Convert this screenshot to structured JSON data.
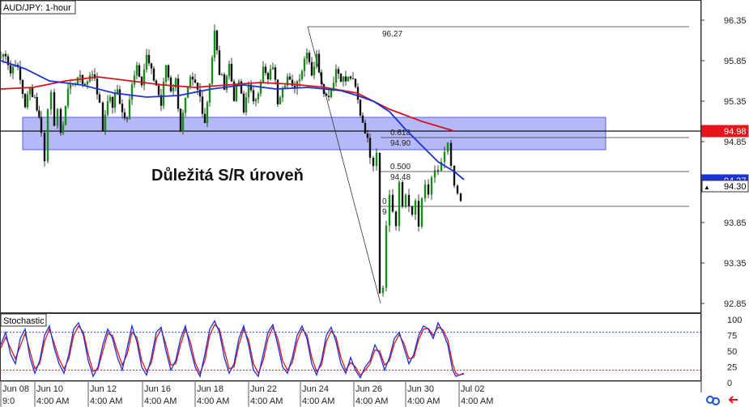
{
  "chart_data": {
    "type": "candlestick",
    "title": "AUD/JPY: 1-hour",
    "price_axis": {
      "ylim": [
        92.74,
        96.58
      ],
      "ticks": [
        "96.35",
        "95.85",
        "95.35",
        "94.85",
        "93.85",
        "93.35",
        "92.85"
      ],
      "tick_values": [
        96.35,
        95.85,
        95.35,
        94.85,
        93.85,
        93.35,
        92.85
      ]
    },
    "x_axis": {
      "date_labels": [
        "Jun 08",
        "Jun 10",
        "Jun 12",
        "Jun 16",
        "Jun 18",
        "Jun 22",
        "Jun 24",
        "Jun 26",
        "Jun 30",
        "Jul 02"
      ],
      "time_labels": [
        "9:0",
        "4:00 AM",
        "4:00 AM",
        "4:00 AM",
        "4:00 AM",
        "4:00 AM",
        "4:00 AM",
        "4:00 AM",
        "4:00 AM",
        "4:00 AM"
      ]
    },
    "close_path": [
      [
        0,
        95.9
      ],
      [
        6,
        95.95
      ],
      [
        12,
        95.7
      ],
      [
        18,
        95.85
      ],
      [
        24,
        95.6
      ],
      [
        30,
        95.3
      ],
      [
        36,
        95.5
      ],
      [
        42,
        95.4
      ],
      [
        50,
        95.0
      ],
      [
        54,
        94.6
      ],
      [
        58,
        95.25
      ],
      [
        62,
        95.5
      ],
      [
        66,
        95.1
      ],
      [
        70,
        95.2
      ],
      [
        74,
        94.9
      ],
      [
        80,
        95.3
      ],
      [
        86,
        95.6
      ],
      [
        92,
        95.55
      ],
      [
        98,
        95.7
      ],
      [
        104,
        95.5
      ],
      [
        110,
        95.7
      ],
      [
        116,
        95.65
      ],
      [
        122,
        95.3
      ],
      [
        126,
        95.0
      ],
      [
        132,
        95.4
      ],
      [
        138,
        95.3
      ],
      [
        144,
        95.5
      ],
      [
        150,
        95.2
      ],
      [
        156,
        95.1
      ],
      [
        162,
        95.6
      ],
      [
        168,
        95.8
      ],
      [
        174,
        95.6
      ],
      [
        180,
        95.9
      ],
      [
        186,
        95.7
      ],
      [
        192,
        95.55
      ],
      [
        198,
        95.3
      ],
      [
        204,
        95.8
      ],
      [
        210,
        95.5
      ],
      [
        216,
        95.6
      ],
      [
        222,
        95.0
      ],
      [
        228,
        95.35
      ],
      [
        234,
        95.6
      ],
      [
        240,
        95.55
      ],
      [
        246,
        95.4
      ],
      [
        252,
        95.1
      ],
      [
        258,
        95.6
      ],
      [
        264,
        96.2
      ],
      [
        270,
        95.7
      ],
      [
        276,
        95.55
      ],
      [
        282,
        95.8
      ],
      [
        288,
        95.4
      ],
      [
        294,
        95.6
      ],
      [
        300,
        95.2
      ],
      [
        306,
        95.6
      ],
      [
        312,
        95.3
      ],
      [
        318,
        95.5
      ],
      [
        324,
        95.75
      ],
      [
        330,
        95.6
      ],
      [
        336,
        95.8
      ],
      [
        342,
        95.35
      ],
      [
        348,
        95.55
      ],
      [
        354,
        95.65
      ],
      [
        360,
        95.5
      ],
      [
        366,
        95.6
      ],
      [
        372,
        95.75
      ],
      [
        378,
        96.0
      ],
      [
        384,
        95.7
      ],
      [
        390,
        95.9
      ],
      [
        396,
        95.6
      ],
      [
        402,
        95.4
      ],
      [
        408,
        95.5
      ],
      [
        414,
        95.75
      ],
      [
        420,
        95.65
      ],
      [
        426,
        95.6
      ],
      [
        432,
        95.65
      ],
      [
        438,
        95.5
      ],
      [
        444,
        95.2
      ],
      [
        450,
        95.0
      ],
      [
        456,
        94.7
      ],
      [
        460,
        94.6
      ],
      [
        464,
        94.75
      ],
      [
        468,
        93.0
      ],
      [
        472,
        93.1
      ],
      [
        476,
        93.8
      ],
      [
        480,
        94.2
      ],
      [
        484,
        94.0
      ],
      [
        488,
        93.8
      ],
      [
        492,
        94.3
      ],
      [
        496,
        94.05
      ],
      [
        500,
        94.2
      ],
      [
        504,
        94.1
      ],
      [
        508,
        93.9
      ],
      [
        512,
        94.1
      ],
      [
        516,
        93.8
      ],
      [
        520,
        94.1
      ],
      [
        524,
        94.3
      ],
      [
        528,
        94.2
      ],
      [
        532,
        94.35
      ],
      [
        536,
        94.45
      ],
      [
        540,
        94.5
      ],
      [
        544,
        94.6
      ],
      [
        548,
        94.7
      ],
      [
        552,
        94.8
      ],
      [
        556,
        94.5
      ],
      [
        560,
        94.3
      ],
      [
        564,
        94.15
      ],
      [
        568,
        94.1
      ],
      [
        572,
        94.3
      ]
    ],
    "ma_blue": [
      [
        0,
        95.85
      ],
      [
        30,
        95.75
      ],
      [
        60,
        95.6
      ],
      [
        100,
        95.55
      ],
      [
        140,
        95.45
      ],
      [
        180,
        95.4
      ],
      [
        220,
        95.42
      ],
      [
        260,
        95.5
      ],
      [
        300,
        95.55
      ],
      [
        340,
        95.5
      ],
      [
        380,
        95.52
      ],
      [
        420,
        95.48
      ],
      [
        440,
        95.42
      ],
      [
        460,
        95.35
      ],
      [
        480,
        95.22
      ],
      [
        500,
        95.0
      ],
      [
        520,
        94.8
      ],
      [
        540,
        94.6
      ],
      [
        560,
        94.48
      ],
      [
        572,
        94.38
      ]
    ],
    "ma_red": [
      [
        0,
        95.5
      ],
      [
        40,
        95.52
      ],
      [
        80,
        95.6
      ],
      [
        120,
        95.65
      ],
      [
        160,
        95.6
      ],
      [
        200,
        95.55
      ],
      [
        240,
        95.52
      ],
      [
        280,
        95.55
      ],
      [
        320,
        95.58
      ],
      [
        360,
        95.56
      ],
      [
        400,
        95.52
      ],
      [
        440,
        95.45
      ],
      [
        480,
        95.25
      ],
      [
        520,
        95.1
      ],
      [
        560,
        94.98
      ]
    ],
    "horizontal_line": {
      "price": 94.98
    },
    "sr_zone": {
      "from": 94.75,
      "to": 95.15,
      "label": "Důležitá S/R úroveň"
    },
    "fibonacci": {
      "high": 96.27,
      "high_label": "96.27",
      "low": 92.85,
      "levels": [
        {
          "ratio": "0.618",
          "price": 94.9,
          "price_label": "94.90"
        },
        {
          "ratio": "0.500",
          "price": 94.48,
          "price_label": "94.48"
        },
        {
          "ratio": "0",
          "price": 94.05,
          "price_label": "9"
        }
      ]
    },
    "price_badges": [
      {
        "label": "94.98",
        "price": 94.98,
        "color": "#e8141c",
        "text_color": "#ffffff"
      },
      {
        "label": "94.37",
        "price": 94.37,
        "color": "#1a32d6",
        "text_color": "#ffffff"
      },
      {
        "label": "94.30",
        "price": 94.3,
        "color": "#ffffff",
        "text_color": "#000000",
        "marker": "▲"
      }
    ],
    "stochastic": {
      "title": "Stochastic",
      "ticks": [
        "100",
        "75",
        "50",
        "25",
        "0"
      ],
      "tick_values": [
        100,
        75,
        50,
        25,
        0
      ],
      "upper": 80,
      "lower": 20,
      "k": [
        [
          0,
          60
        ],
        [
          6,
          80
        ],
        [
          12,
          45
        ],
        [
          18,
          30
        ],
        [
          24,
          70
        ],
        [
          30,
          85
        ],
        [
          36,
          40
        ],
        [
          42,
          15
        ],
        [
          48,
          35
        ],
        [
          54,
          75
        ],
        [
          60,
          90
        ],
        [
          66,
          55
        ],
        [
          72,
          30
        ],
        [
          78,
          15
        ],
        [
          84,
          45
        ],
        [
          90,
          85
        ],
        [
          96,
          95
        ],
        [
          102,
          75
        ],
        [
          108,
          35
        ],
        [
          114,
          10
        ],
        [
          120,
          25
        ],
        [
          126,
          60
        ],
        [
          132,
          85
        ],
        [
          138,
          70
        ],
        [
          144,
          40
        ],
        [
          150,
          20
        ],
        [
          156,
          55
        ],
        [
          162,
          90
        ],
        [
          168,
          65
        ],
        [
          174,
          25
        ],
        [
          180,
          12
        ],
        [
          186,
          40
        ],
        [
          192,
          80
        ],
        [
          198,
          88
        ],
        [
          204,
          50
        ],
        [
          210,
          20
        ],
        [
          216,
          35
        ],
        [
          222,
          70
        ],
        [
          228,
          90
        ],
        [
          234,
          55
        ],
        [
          240,
          25
        ],
        [
          246,
          10
        ],
        [
          252,
          45
        ],
        [
          258,
          85
        ],
        [
          264,
          98
        ],
        [
          270,
          80
        ],
        [
          276,
          40
        ],
        [
          282,
          15
        ],
        [
          288,
          30
        ],
        [
          294,
          70
        ],
        [
          300,
          90
        ],
        [
          306,
          60
        ],
        [
          312,
          20
        ],
        [
          318,
          10
        ],
        [
          324,
          45
        ],
        [
          330,
          80
        ],
        [
          336,
          92
        ],
        [
          342,
          60
        ],
        [
          348,
          25
        ],
        [
          354,
          15
        ],
        [
          360,
          40
        ],
        [
          366,
          75
        ],
        [
          372,
          90
        ],
        [
          378,
          70
        ],
        [
          384,
          30
        ],
        [
          390,
          12
        ],
        [
          396,
          35
        ],
        [
          402,
          75
        ],
        [
          408,
          88
        ],
        [
          414,
          65
        ],
        [
          420,
          30
        ],
        [
          426,
          15
        ],
        [
          432,
          40
        ],
        [
          438,
          20
        ],
        [
          444,
          8
        ],
        [
          450,
          25
        ],
        [
          456,
          35
        ],
        [
          462,
          60
        ],
        [
          468,
          45
        ],
        [
          474,
          20
        ],
        [
          480,
          40
        ],
        [
          486,
          70
        ],
        [
          492,
          80
        ],
        [
          498,
          55
        ],
        [
          504,
          30
        ],
        [
          510,
          45
        ],
        [
          516,
          75
        ],
        [
          522,
          90
        ],
        [
          528,
          85
        ],
        [
          534,
          70
        ],
        [
          540,
          95
        ],
        [
          546,
          80
        ],
        [
          552,
          60
        ],
        [
          558,
          20
        ],
        [
          562,
          10
        ],
        [
          566,
          12
        ],
        [
          572,
          15
        ]
      ],
      "d": [
        [
          0,
          55
        ],
        [
          6,
          72
        ],
        [
          12,
          55
        ],
        [
          18,
          38
        ],
        [
          24,
          58
        ],
        [
          30,
          78
        ],
        [
          36,
          50
        ],
        [
          42,
          22
        ],
        [
          48,
          30
        ],
        [
          54,
          65
        ],
        [
          60,
          85
        ],
        [
          66,
          62
        ],
        [
          72,
          38
        ],
        [
          78,
          22
        ],
        [
          84,
          38
        ],
        [
          90,
          75
        ],
        [
          96,
          90
        ],
        [
          102,
          80
        ],
        [
          108,
          45
        ],
        [
          114,
          18
        ],
        [
          120,
          22
        ],
        [
          126,
          50
        ],
        [
          132,
          78
        ],
        [
          138,
          75
        ],
        [
          144,
          50
        ],
        [
          150,
          28
        ],
        [
          156,
          45
        ],
        [
          162,
          80
        ],
        [
          168,
          72
        ],
        [
          174,
          35
        ],
        [
          180,
          18
        ],
        [
          186,
          32
        ],
        [
          192,
          70
        ],
        [
          198,
          85
        ],
        [
          204,
          60
        ],
        [
          210,
          28
        ],
        [
          216,
          30
        ],
        [
          222,
          60
        ],
        [
          228,
          85
        ],
        [
          234,
          65
        ],
        [
          240,
          32
        ],
        [
          246,
          15
        ],
        [
          252,
          35
        ],
        [
          258,
          75
        ],
        [
          264,
          92
        ],
        [
          270,
          85
        ],
        [
          276,
          52
        ],
        [
          282,
          22
        ],
        [
          288,
          25
        ],
        [
          294,
          60
        ],
        [
          300,
          85
        ],
        [
          306,
          68
        ],
        [
          312,
          30
        ],
        [
          318,
          15
        ],
        [
          324,
          35
        ],
        [
          330,
          70
        ],
        [
          336,
          88
        ],
        [
          342,
          70
        ],
        [
          348,
          35
        ],
        [
          354,
          20
        ],
        [
          360,
          32
        ],
        [
          366,
          65
        ],
        [
          372,
          85
        ],
        [
          378,
          76
        ],
        [
          384,
          40
        ],
        [
          390,
          18
        ],
        [
          396,
          28
        ],
        [
          402,
          65
        ],
        [
          408,
          82
        ],
        [
          414,
          72
        ],
        [
          420,
          40
        ],
        [
          426,
          20
        ],
        [
          432,
          32
        ],
        [
          438,
          25
        ],
        [
          444,
          12
        ],
        [
          450,
          20
        ],
        [
          456,
          30
        ],
        [
          462,
          52
        ],
        [
          468,
          50
        ],
        [
          474,
          28
        ],
        [
          480,
          35
        ],
        [
          486,
          62
        ],
        [
          492,
          76
        ],
        [
          498,
          62
        ],
        [
          504,
          38
        ],
        [
          510,
          40
        ],
        [
          516,
          68
        ],
        [
          522,
          85
        ],
        [
          528,
          86
        ],
        [
          534,
          75
        ],
        [
          540,
          88
        ],
        [
          546,
          84
        ],
        [
          552,
          68
        ],
        [
          558,
          30
        ],
        [
          562,
          15
        ],
        [
          566,
          12
        ],
        [
          572,
          14
        ]
      ]
    }
  }
}
